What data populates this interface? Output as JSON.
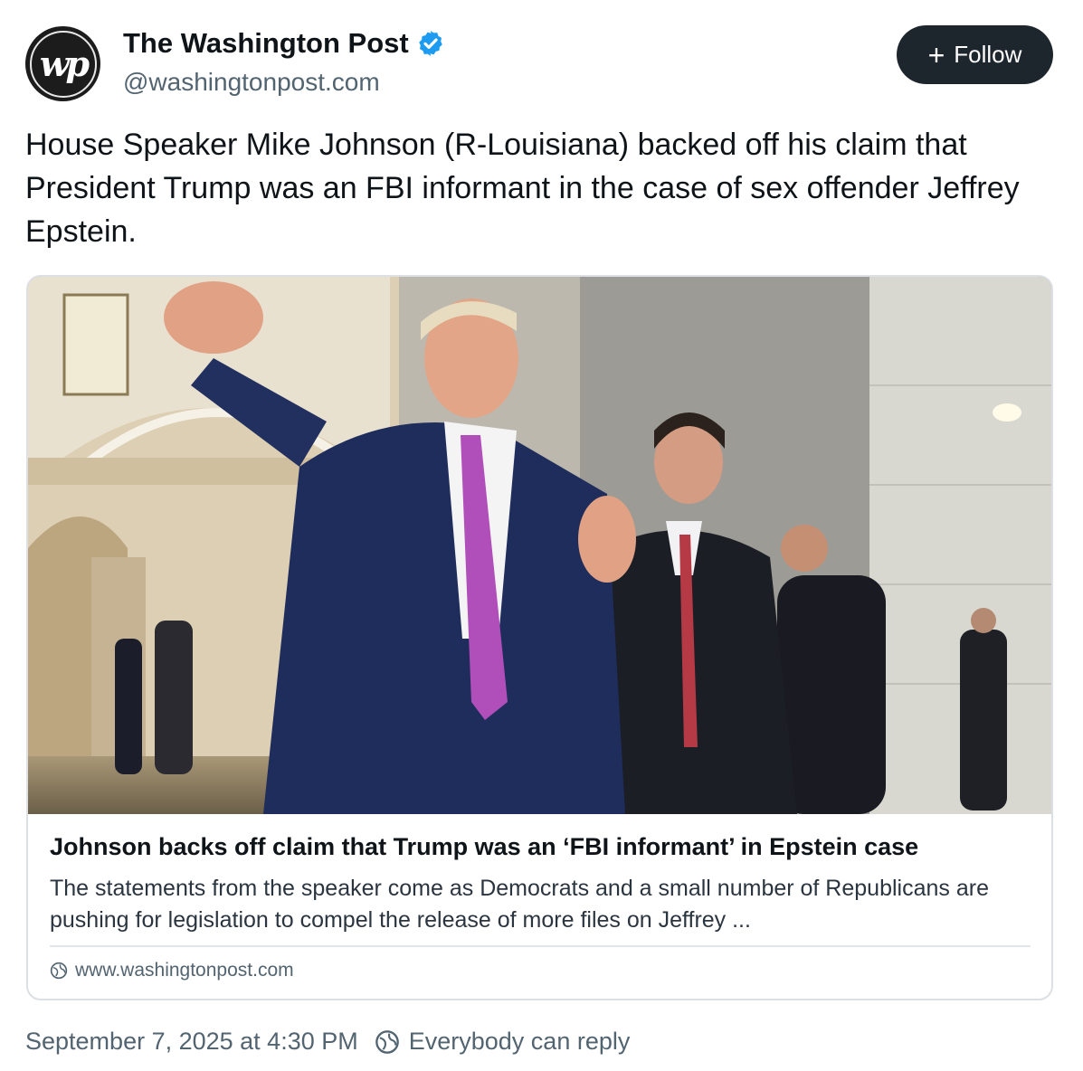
{
  "author": {
    "name": "The Washington Post",
    "handle": "@washingtonpost.com",
    "avatar_text": "wp",
    "verified": true,
    "verified_color": "#1d9bf0"
  },
  "follow_button": {
    "icon": "plus-icon",
    "label": "Follow"
  },
  "post": {
    "text": "House Speaker Mike Johnson (R-Louisiana) backed off his claim that President Trump was an FBI informant in the case of sex offender Jeffrey Epstein."
  },
  "link_card": {
    "title": "Johnson backs off claim that Trump was an ‘FBI informant’ in Epstein case",
    "description": "The statements from the speaker come as Democrats and a small number of Republicans are pushing for legislation to compel the release of more files on Jeffrey ...",
    "domain": "www.washingtonpost.com",
    "domain_icon": "globe-icon"
  },
  "footer": {
    "timestamp": "September 7, 2025 at 4:30 PM",
    "reply_icon": "globe-icon",
    "reply_setting": "Everybody can reply"
  },
  "colors": {
    "follow_bg": "#1d252d",
    "secondary_text": "#536471",
    "card_border": "#dcdfe3"
  }
}
